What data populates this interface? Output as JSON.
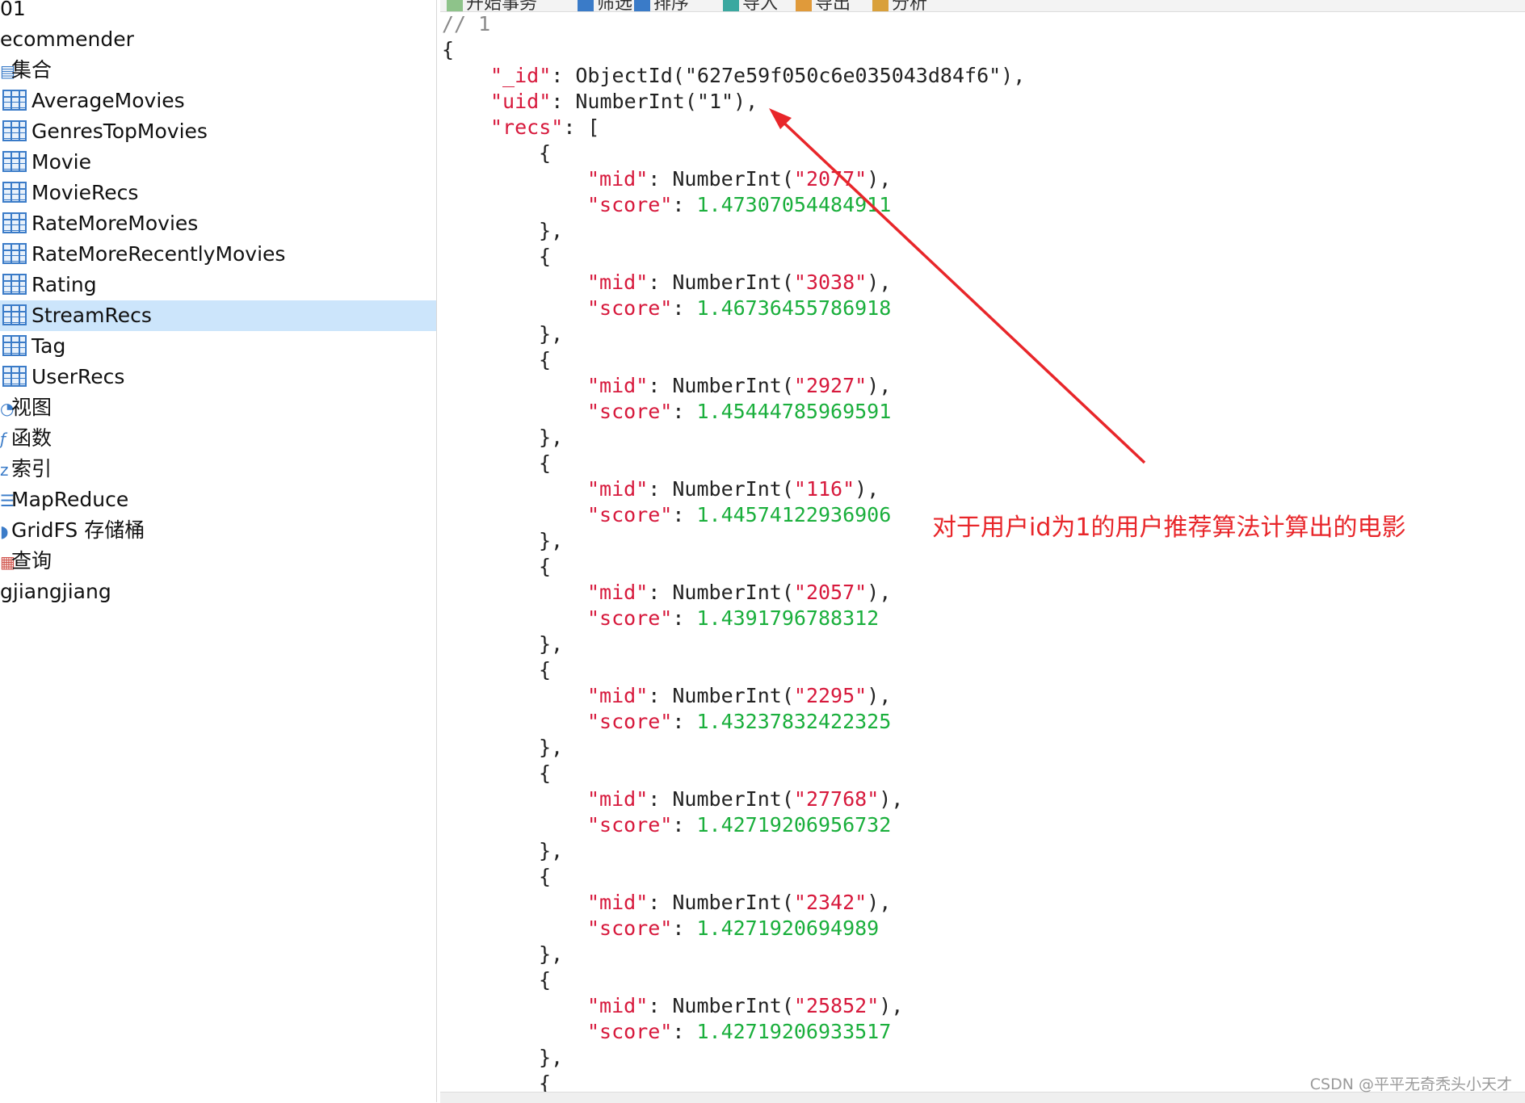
{
  "sidebar": {
    "connection": "01",
    "database": "ecommender",
    "collections_group": "集合",
    "collections": [
      "AverageMovies",
      "GenresTopMovies",
      "Movie",
      "MovieRecs",
      "RateMoreMovies",
      "RateMoreRecentlyMovies",
      "Rating",
      "StreamRecs",
      "Tag",
      "UserRecs"
    ],
    "selected": "StreamRecs",
    "other_groups": [
      "视图",
      "函数",
      "索引",
      "MapReduce",
      "GridFS 存储桶",
      "查询"
    ],
    "other_database": "gjiangjiang"
  },
  "toolbar": {
    "items": [
      "开始事务",
      "筛选",
      "排序",
      "导入",
      "导出",
      "分析"
    ]
  },
  "document": {
    "comment": "// 1",
    "id_key": "\"_id\"",
    "id_value": "ObjectId(\"627e59f050c6e035043d84f6\"),",
    "uid_key": "\"uid\"",
    "uid_value": "NumberInt(\"1\"),",
    "recs_key": "\"recs\"",
    "recs": [
      {
        "mid": "2077",
        "score": "1.47307054484911"
      },
      {
        "mid": "3038",
        "score": "1.46736455786918"
      },
      {
        "mid": "2927",
        "score": "1.45444785969591"
      },
      {
        "mid": "116",
        "score": "1.44574122936906"
      },
      {
        "mid": "2057",
        "score": "1.4391796788312"
      },
      {
        "mid": "2295",
        "score": "1.43237832422325"
      },
      {
        "mid": "27768",
        "score": "1.42719206956732"
      },
      {
        "mid": "2342",
        "score": "1.4271920694989"
      },
      {
        "mid": "25852",
        "score": "1.42719206933517"
      }
    ]
  },
  "annotation": "对于用户id为1的用户推荐算法计算出的电影",
  "watermark": "CSDN @平平无奇秃头小天才",
  "colors": {
    "key": "#d7193c",
    "number": "#1aaf3c",
    "annotation": "#e8262a",
    "selection": "#cce5fb"
  }
}
